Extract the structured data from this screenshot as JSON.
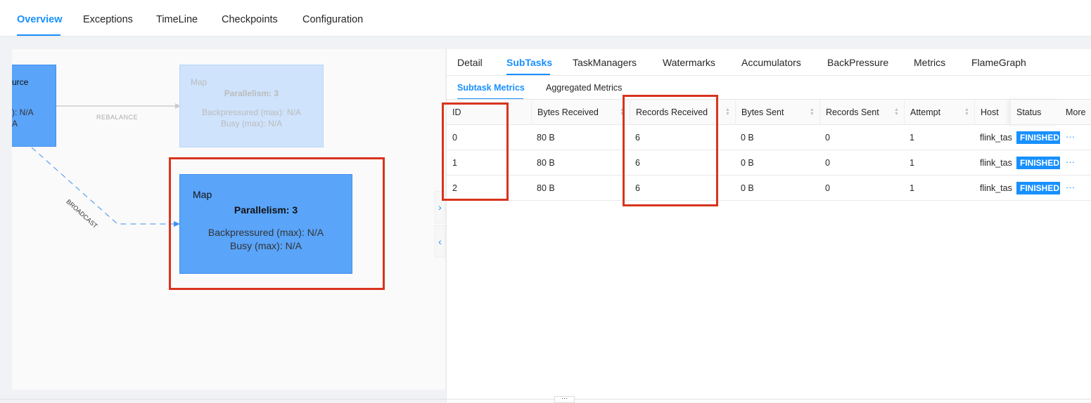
{
  "top_tabs": [
    "Overview",
    "Exceptions",
    "TimeLine",
    "Checkpoints",
    "Configuration"
  ],
  "graph": {
    "source": {
      "name": "urce",
      "l1": "): N/A",
      "l2": "A"
    },
    "map1": {
      "name": "Map",
      "parallelism": "Parallelism: 3",
      "backpressured": "Backpressured (max): N/A",
      "busy": "Busy (max): N/A"
    },
    "map2": {
      "name": "Map",
      "parallelism": "Parallelism: 3",
      "backpressured": "Backpressured (max): N/A",
      "busy": "Busy (max): N/A"
    },
    "edge1": "REBALANCE",
    "edge2": "BROADCAST"
  },
  "detail_tabs": [
    "Detail",
    "SubTasks",
    "TaskManagers",
    "Watermarks",
    "Accumulators",
    "BackPressure",
    "Metrics",
    "FlameGraph"
  ],
  "sub_tabs": [
    "Subtask Metrics",
    "Aggregated Metrics"
  ],
  "table": {
    "headers": [
      "ID",
      "Bytes Received",
      "Records Received",
      "Bytes Sent",
      "Records Sent",
      "Attempt",
      "Host",
      "Status",
      "More"
    ],
    "rows": [
      [
        "0",
        "80 B",
        "6",
        "0 B",
        "0",
        "1",
        "flink_tas",
        "FINISHED"
      ],
      [
        "1",
        "80 B",
        "6",
        "0 B",
        "0",
        "1",
        "flink_tas",
        "FINISHED"
      ],
      [
        "2",
        "80 B",
        "6",
        "0 B",
        "0",
        "1",
        "flink_tas",
        "FINISHED"
      ]
    ],
    "more_icon": "ellipsis-icon"
  },
  "accent": "#1890ff",
  "highlight": "#d8341e"
}
